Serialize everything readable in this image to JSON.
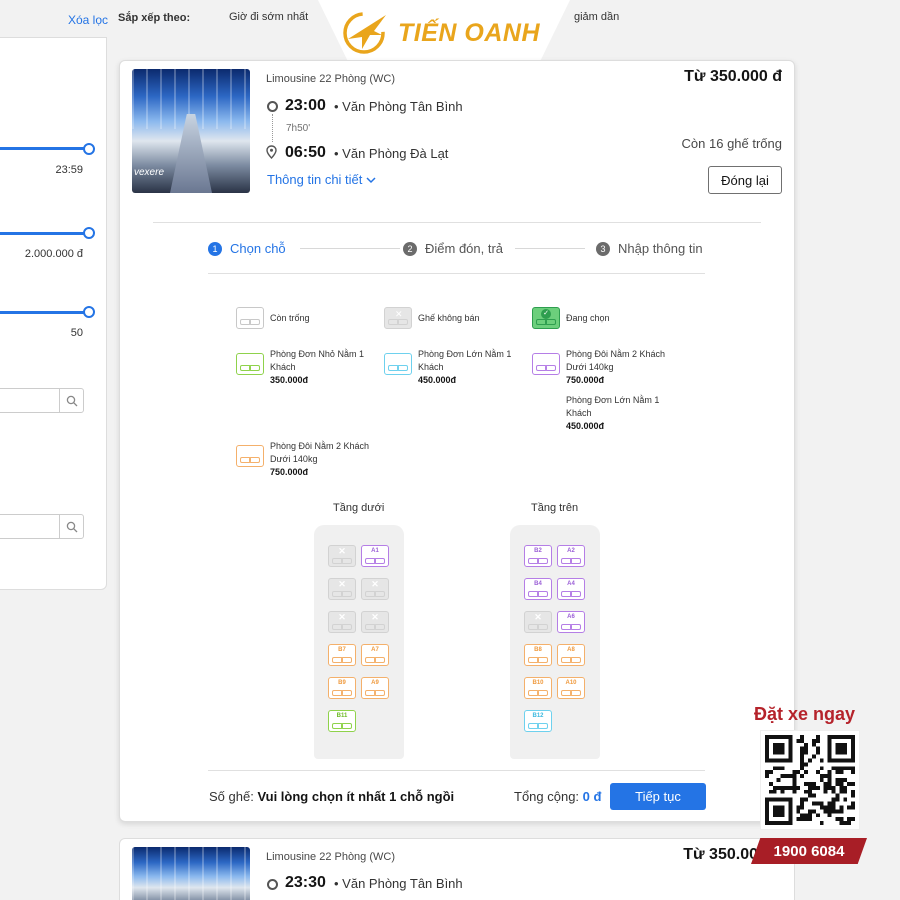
{
  "filters": {
    "clear_label": "Xóa lọc",
    "time_max": "23:59",
    "price_max": "2.000.000 đ",
    "seats_max": "50"
  },
  "sort": {
    "label": "Sắp xếp theo:",
    "option_1": "Giờ đi sớm nhất",
    "option_2": "giảm dần"
  },
  "logo": {
    "text": "TIẾN OANH"
  },
  "trip": {
    "bus_type": "Limousine 22 Phòng (WC)",
    "price": "Từ 350.000 đ",
    "depart_time": "23:00",
    "depart_place": "Văn Phòng Tân Bình",
    "duration": "7h50'",
    "arrive_time": "06:50",
    "arrive_place": "Văn Phòng Đà Lạt",
    "seats_left": "Còn 16 ghế trống",
    "detail_link": "Thông tin chi tiết",
    "close_label": "Đóng lại",
    "photo_watermark": "vexere"
  },
  "steps": [
    {
      "num": "1",
      "label": "Chọn chỗ"
    },
    {
      "num": "2",
      "label": "Điểm đón, trả"
    },
    {
      "num": "3",
      "label": "Nhập thông tin"
    }
  ],
  "legend": {
    "available": "Còn trống",
    "not_sold": "Ghế không bán",
    "selected": "Đang chọn",
    "types": [
      {
        "name": "Phòng Đơn Nhỏ Nằm 1 Khách",
        "price": "350.000đ",
        "color": "#8fd24b"
      },
      {
        "name": "Phòng Đơn Lớn Nằm 1 Khách",
        "price": "450.000đ",
        "color": "#6ed1ee"
      },
      {
        "name": "Phòng Đôi Nằm 2 Khách Dưới 140kg",
        "price": "750.000đ",
        "color": "#b57ee6"
      },
      {
        "name": "Phòng Đơn Lớn Nằm 1 Khách",
        "price": "450.000đ",
        "color": "#b57ee6"
      },
      {
        "name": "Phòng Đôi Nằm 2 Khách Dưới 140kg",
        "price": "750.000đ",
        "color": "#f4b06b"
      }
    ]
  },
  "decks": {
    "lower": {
      "title": "Tầng dưới",
      "seats": [
        {
          "label": "",
          "type": "x"
        },
        {
          "label": "A1",
          "type": "purple"
        },
        {
          "label": "",
          "type": "x"
        },
        {
          "label": "",
          "type": "x"
        },
        {
          "label": "",
          "type": "x"
        },
        {
          "label": "",
          "type": "x"
        },
        {
          "label": "B7",
          "type": "orange"
        },
        {
          "label": "A7",
          "type": "orange"
        },
        {
          "label": "B9",
          "type": "orange"
        },
        {
          "label": "A9",
          "type": "orange"
        },
        {
          "label": "B11",
          "type": "green"
        }
      ]
    },
    "upper": {
      "title": "Tầng trên",
      "seats": [
        {
          "label": "B2",
          "type": "purple"
        },
        {
          "label": "A2",
          "type": "purple"
        },
        {
          "label": "B4",
          "type": "purple"
        },
        {
          "label": "A4",
          "type": "purple"
        },
        {
          "label": "",
          "type": "x"
        },
        {
          "label": "A6",
          "type": "purple"
        },
        {
          "label": "B8",
          "type": "orange"
        },
        {
          "label": "A8",
          "type": "orange"
        },
        {
          "label": "B10",
          "type": "orange"
        },
        {
          "label": "A10",
          "type": "orange"
        },
        {
          "label": "B12",
          "type": "cyan"
        }
      ]
    }
  },
  "footer": {
    "seat_label": "Số ghế:",
    "seat_value": "Vui lòng chọn ít nhất 1 chỗ ngồi",
    "total_label": "Tổng cộng:",
    "total_value": "0 đ",
    "continue_label": "Tiếp tục"
  },
  "trip2": {
    "bus_type": "Limousine 22 Phòng (WC)",
    "price": "Từ 350.00",
    "depart_time": "23:30",
    "depart_place": "Văn Phòng Tân Bình"
  },
  "promo": {
    "book_now": "Đặt xe ngay",
    "hotline": "1900 6084"
  },
  "colors": {
    "accent": "#2474e5",
    "brand_red": "#a81e26",
    "logo_gold": "#e9a51c"
  }
}
